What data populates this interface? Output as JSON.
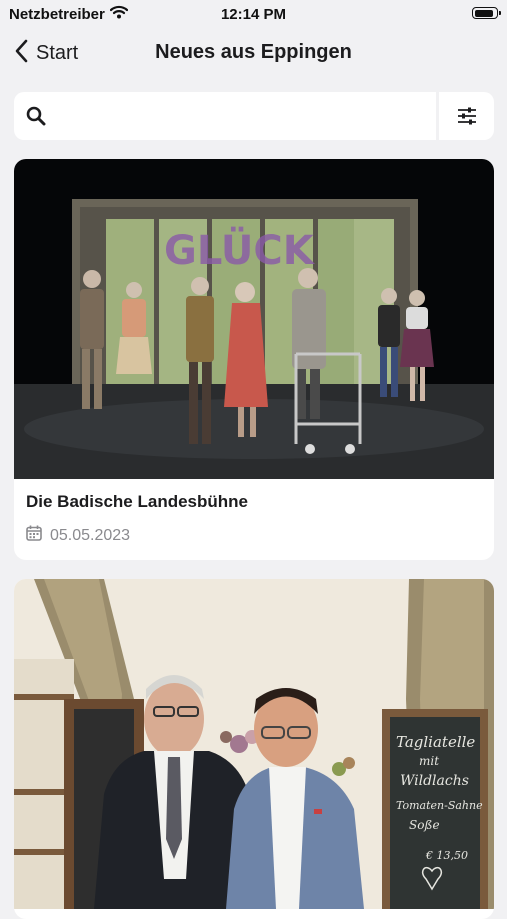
{
  "status_bar": {
    "carrier": "Netzbetreiber",
    "time": "12:14 PM",
    "battery_level": 0.9
  },
  "nav": {
    "back_label": "Start",
    "title": "Neues aus Eppingen"
  },
  "search": {
    "value": "",
    "placeholder": ""
  },
  "articles": [
    {
      "title": "Die Badische Landesbühne",
      "date": "05.05.2023",
      "stage_sign_text": "GLÜCK"
    },
    {
      "title": "",
      "date": "",
      "chalkboard_lines": [
        "Tagliatelle",
        "mit",
        "Wildlachs",
        "Tomaten-Sahne",
        "Soße",
        "€ 13,50"
      ]
    }
  ],
  "colors": {
    "background": "#f1f1f3",
    "card": "#ffffff",
    "text": "#1c1c1e",
    "secondary_text": "#8a8a8e"
  }
}
